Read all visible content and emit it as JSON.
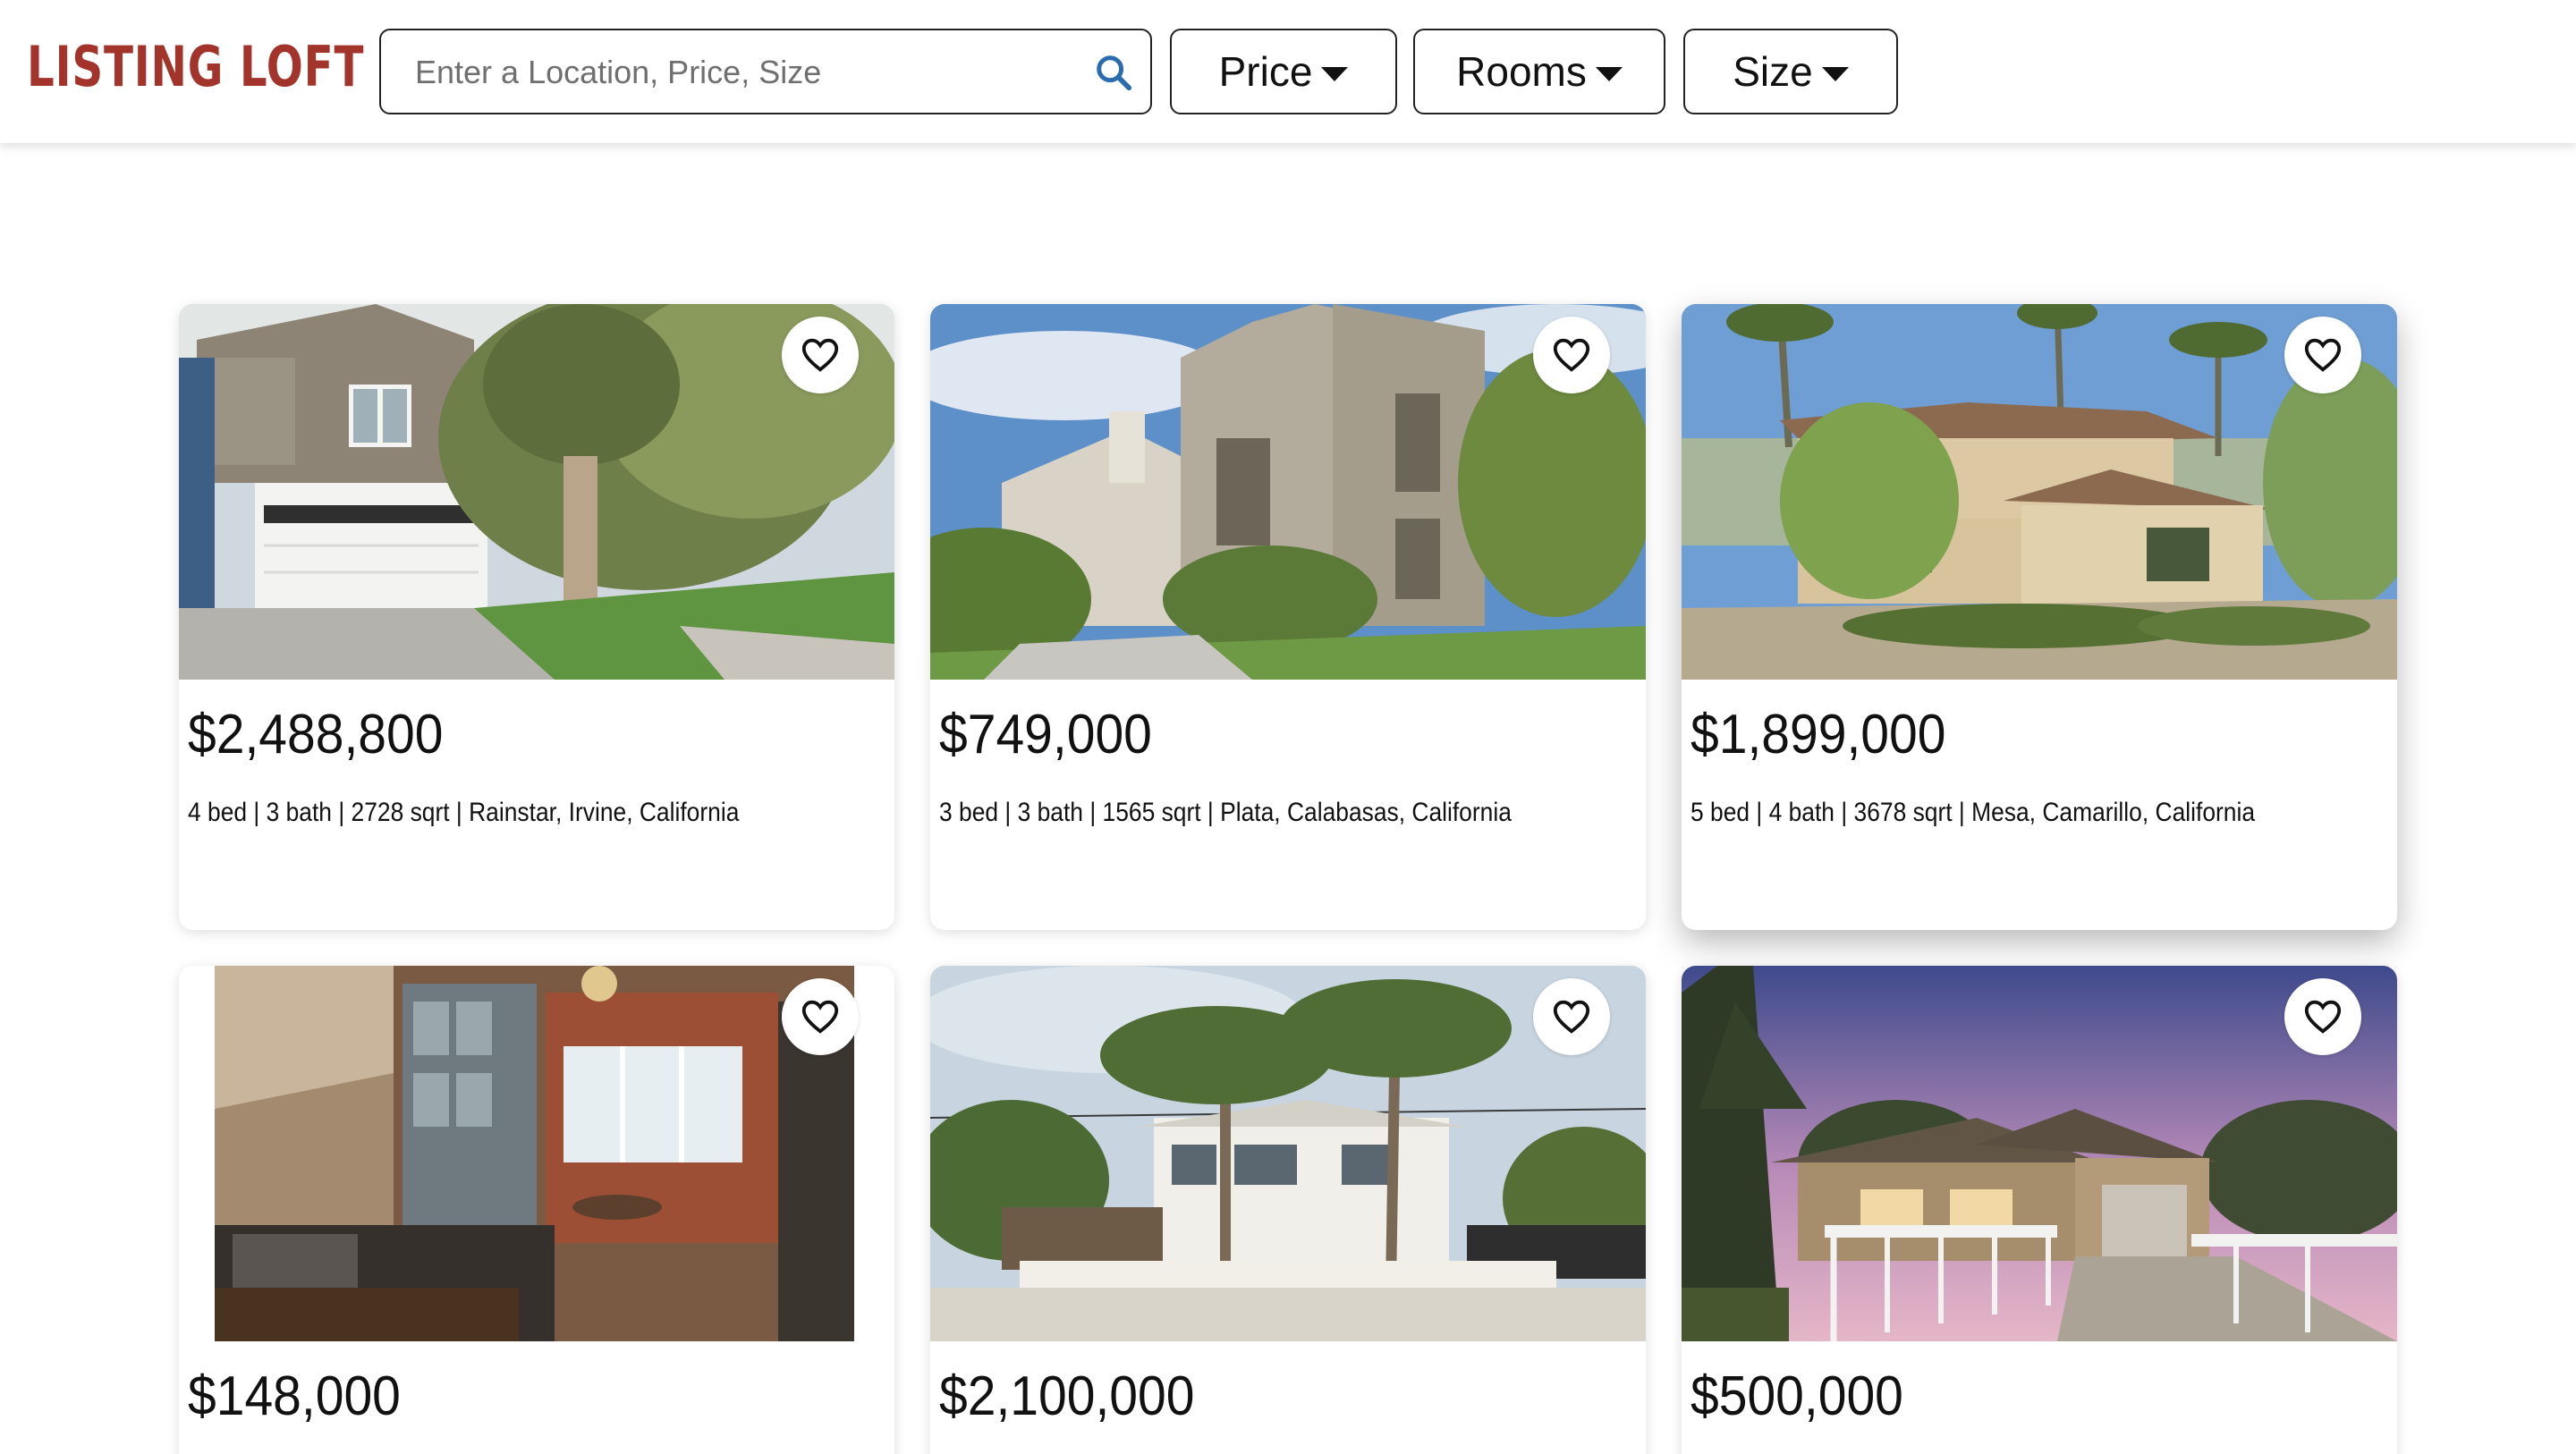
{
  "app": {
    "logo": "LISTING LOFT"
  },
  "search": {
    "placeholder": "Enter a Location, Price, Size",
    "value": ""
  },
  "filters": [
    {
      "label": "Price"
    },
    {
      "label": "Rooms"
    },
    {
      "label": "Size"
    }
  ],
  "listings": [
    {
      "price": "$2,488,800",
      "details": "4 bed | 3 bath | 2728 sqrt | Rainstar, Irvine, California",
      "photo": "two-story house with garage and large tree",
      "favorited": false
    },
    {
      "price": "$749,000",
      "details": "3 bed | 3 bath | 1565 sqrt | Plata, Calabasas, California",
      "photo": "tall stucco townhouses",
      "favorited": false
    },
    {
      "price": "$1,899,000",
      "details": "5 bed | 4 bath | 3678 sqrt | Mesa, Camarillo, California",
      "photo": "mediterranean estate with palm trees",
      "favorited": false
    },
    {
      "price": "$148,000",
      "details": "",
      "photo": "kitchen and dining interior",
      "favorited": false
    },
    {
      "price": "$2,100,000",
      "details": "",
      "photo": "white beach house with palm trees",
      "favorited": false
    },
    {
      "price": "$500,000",
      "details": "",
      "photo": "ranch house at dusk with pine trees",
      "favorited": false
    }
  ],
  "colors": {
    "brand": "#a2342b",
    "search_icon": "#2b6cb0",
    "border": "#222222"
  },
  "icons": {
    "search": "search-icon",
    "favorite": "heart-outline-icon",
    "dropdown": "caret-down-icon"
  }
}
